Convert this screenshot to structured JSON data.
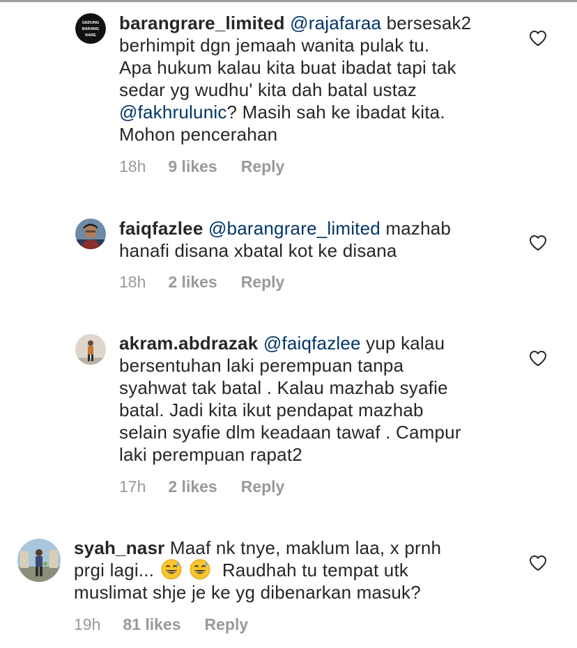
{
  "comments": [
    {
      "username": "barangrare_limited",
      "avatar_text": [
        "GEDUNG",
        "BARANG",
        "RARE"
      ],
      "lines": [
        [
          {
            "t": "mention",
            "v": "@rajafaraa"
          },
          {
            "t": "text",
            "v": " bersesak2"
          }
        ],
        [
          {
            "t": "text",
            "v": "berhimpit dgn jemaah wanita pulak tu."
          }
        ],
        [
          {
            "t": "text",
            "v": "Apa hukum kalau kita buat ibadat tapi tak"
          }
        ],
        [
          {
            "t": "text",
            "v": "sedar yg wudhu' kita dah batal ustaz"
          }
        ],
        [
          {
            "t": "mention",
            "v": "@fakhrulunic"
          },
          {
            "t": "text",
            "v": "? Masih sah ke ibadat kita."
          }
        ],
        [
          {
            "t": "text",
            "v": "Mohon pencerahan"
          }
        ]
      ],
      "time": "18h",
      "likes": "9 likes",
      "reply": "Reply"
    },
    {
      "username": "faiqfazlee",
      "lines": [
        [
          {
            "t": "mention",
            "v": "@barangrare_limited"
          },
          {
            "t": "text",
            "v": " mazhab"
          }
        ],
        [
          {
            "t": "text",
            "v": "hanafi disana xbatal kot ke disana"
          }
        ]
      ],
      "time": "18h",
      "likes": "2 likes",
      "reply": "Reply"
    },
    {
      "username": "akram.abdrazak",
      "lines": [
        [
          {
            "t": "mention",
            "v": "@faiqfazlee"
          },
          {
            "t": "text",
            "v": " yup kalau"
          }
        ],
        [
          {
            "t": "text",
            "v": "bersentuhan laki perempuan tanpa"
          }
        ],
        [
          {
            "t": "text",
            "v": "syahwat tak batal . Kalau mazhab syafie"
          }
        ],
        [
          {
            "t": "text",
            "v": "batal. Jadi kita ikut pendapat mazhab"
          }
        ],
        [
          {
            "t": "text",
            "v": "selain syafie dlm keadaan tawaf . Campur"
          }
        ],
        [
          {
            "t": "text",
            "v": "laki perempuan rapat2"
          }
        ]
      ],
      "time": "17h",
      "likes": "2 likes",
      "reply": "Reply"
    },
    {
      "username": "syah_nasr",
      "lines": [
        [
          {
            "t": "text",
            "v": " Maaf nk tnye, maklum laa, x prnh"
          }
        ],
        [
          {
            "t": "text",
            "v": "prgi lagi... "
          },
          {
            "t": "emoji",
            "v": "sweat-smile-emoji"
          },
          {
            "t": "text",
            "v": " "
          },
          {
            "t": "emoji",
            "v": "sweat-smile-emoji"
          },
          {
            "t": "text",
            "v": "  Raudhah tu tempat utk"
          }
        ],
        [
          {
            "t": "text",
            "v": "muslimat shje je ke yg dibenarkan masuk?"
          }
        ]
      ],
      "time": "19h",
      "likes": "81 likes",
      "reply": "Reply"
    }
  ],
  "icons": {
    "like": "heart-outline-icon",
    "emoji": "sweat-smile-emoji"
  },
  "colors": {
    "text": "#262626",
    "mention": "#003569",
    "meta": "#999999",
    "heart": "#262626"
  }
}
